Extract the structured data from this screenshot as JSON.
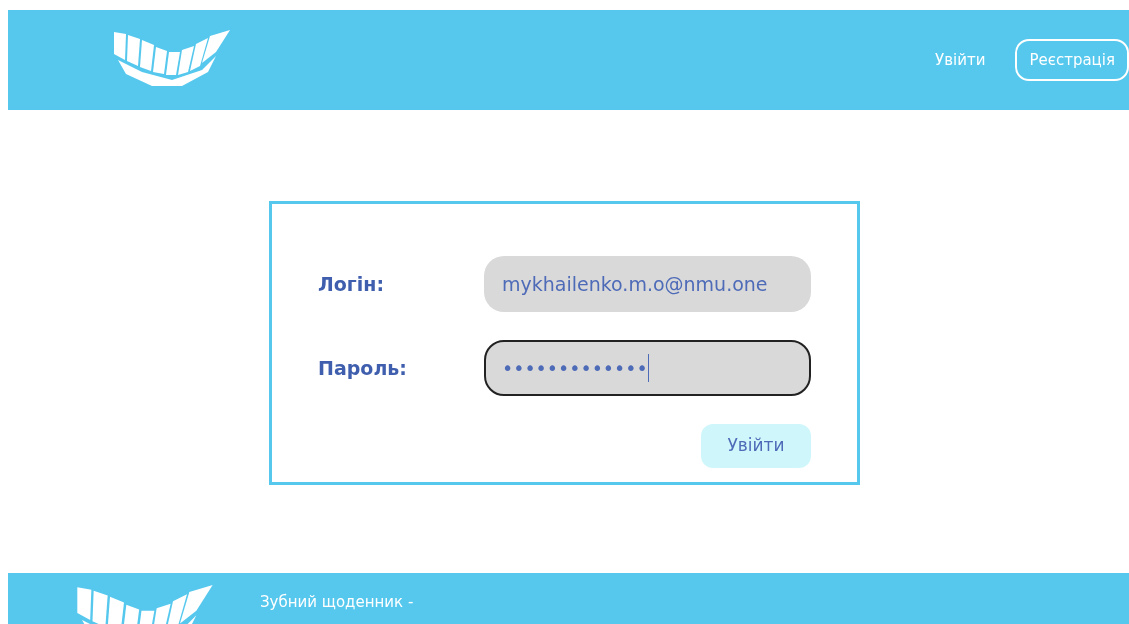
{
  "header": {
    "nav": [
      {
        "label": "Увійти",
        "kind": "link"
      },
      {
        "label": "Реєстрація",
        "kind": "outlined"
      }
    ]
  },
  "login_form": {
    "fields": [
      {
        "label": "Логін:",
        "value": "mykhailenko.m.o@nmu.one",
        "focused": false
      },
      {
        "label": "Пароль:",
        "value": "•••••••••••••",
        "focused": true
      }
    ],
    "submit": "Увійти"
  },
  "footer": {
    "tagline": "Зубний щоденник -"
  }
}
